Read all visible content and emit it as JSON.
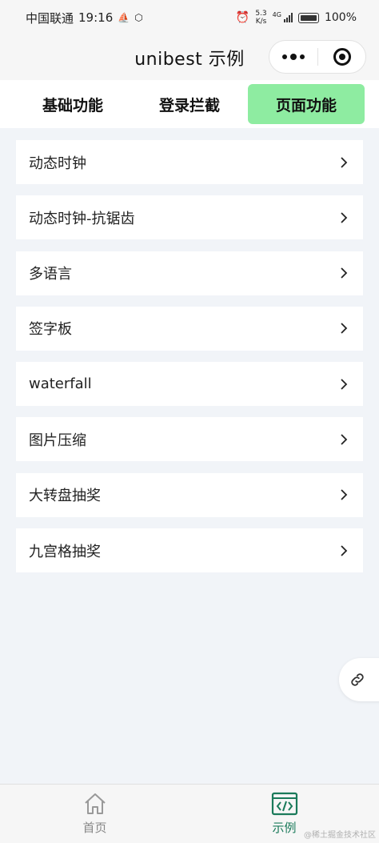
{
  "status_bar": {
    "carrier": "中国联通",
    "time": "19:16",
    "speed_value": "5.3",
    "speed_unit": "K/s",
    "network": "4G",
    "battery": "100%"
  },
  "navbar": {
    "title": "unibest 示例"
  },
  "tabs": [
    {
      "label": "基础功能",
      "active": false
    },
    {
      "label": "登录拦截",
      "active": false
    },
    {
      "label": "页面功能",
      "active": true
    }
  ],
  "list": [
    {
      "label": "动态时钟"
    },
    {
      "label": "动态时钟-抗锯齿"
    },
    {
      "label": "多语言"
    },
    {
      "label": "签字板"
    },
    {
      "label": "waterfall"
    },
    {
      "label": "图片压缩"
    },
    {
      "label": "大转盘抽奖"
    },
    {
      "label": "九宫格抽奖"
    }
  ],
  "tabbar": [
    {
      "label": "首页",
      "icon": "home-icon",
      "active": false
    },
    {
      "label": "示例",
      "icon": "code-icon",
      "active": true
    }
  ],
  "watermark": "@稀土掘金技术社区",
  "colors": {
    "accent": "#8eeca1",
    "tabbar_active": "#1a7a5a"
  }
}
